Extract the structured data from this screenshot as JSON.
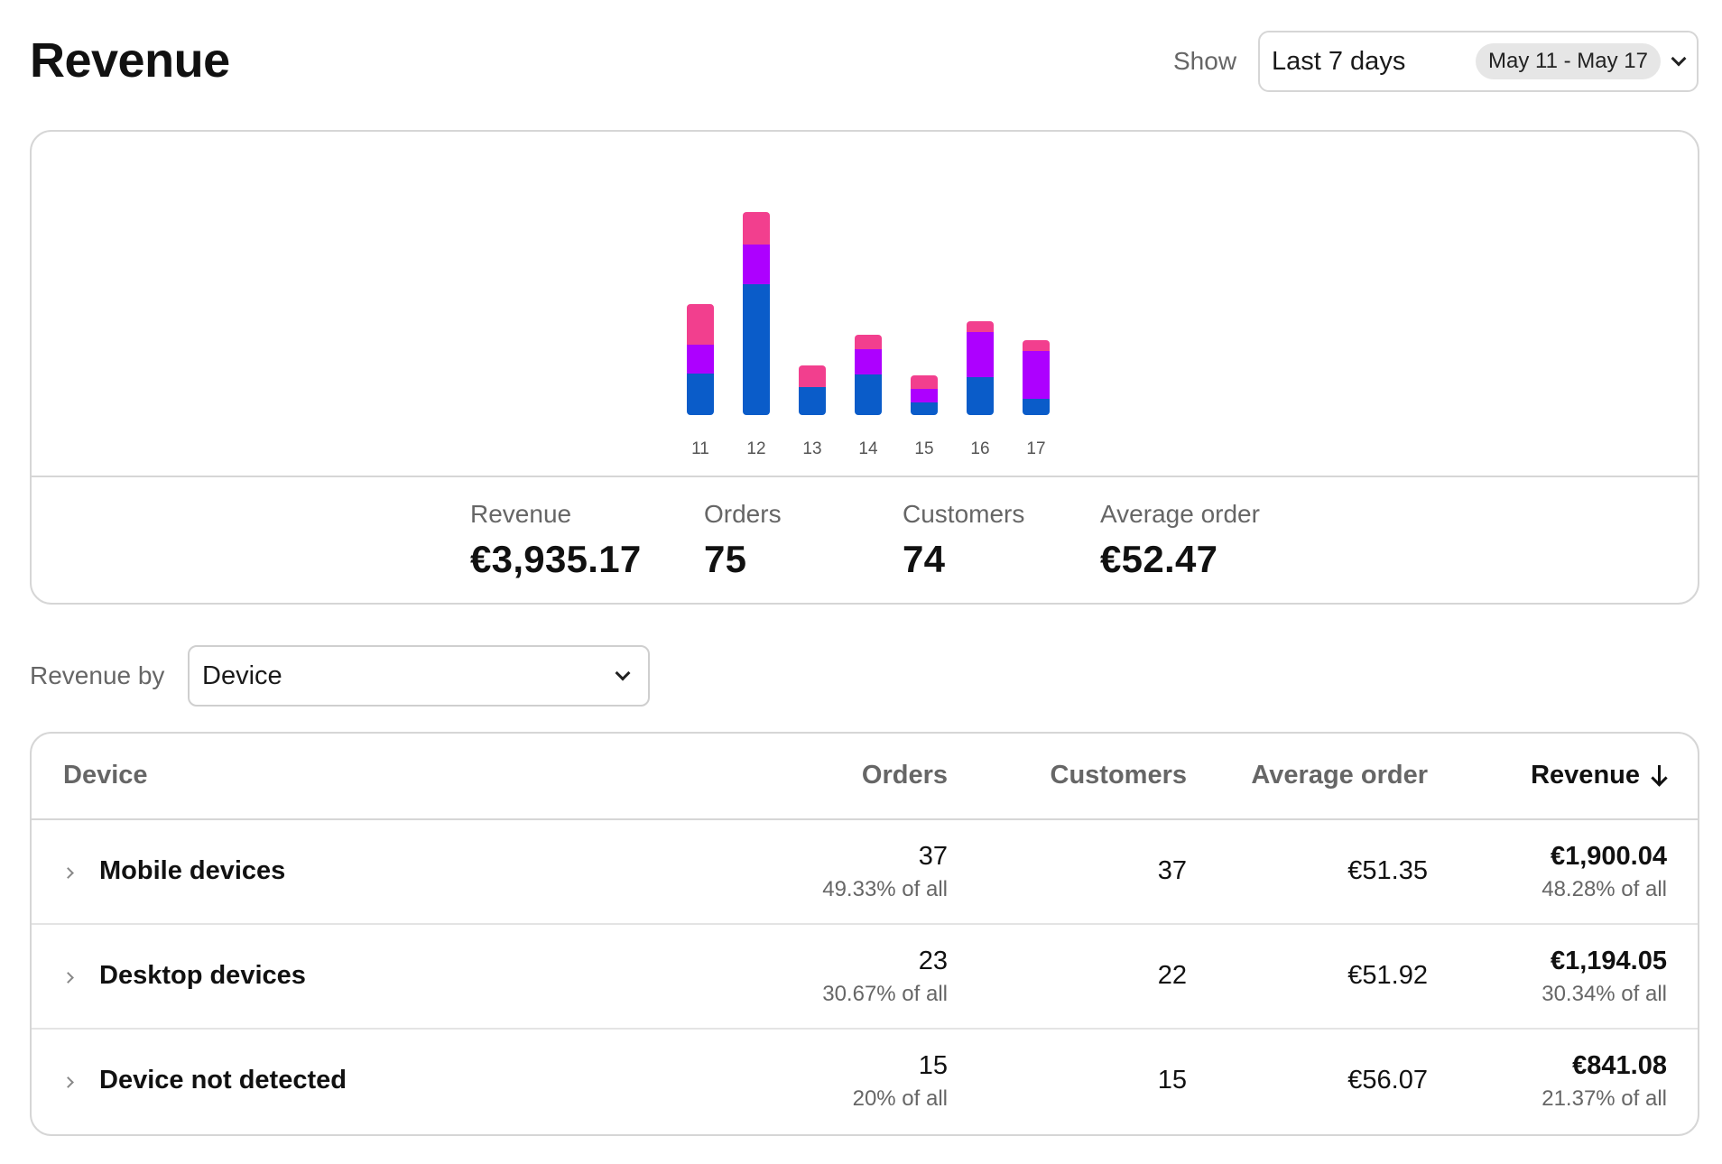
{
  "header": {
    "title": "Revenue",
    "show_label": "Show",
    "range_label": "Last 7 days",
    "range_pill": "May 11 - May 17"
  },
  "colors": {
    "blue": "#0a5cc9",
    "purple": "#ad00ff",
    "pink": "#f23f8e",
    "border": "#d6d6d6"
  },
  "chart_data": {
    "type": "bar",
    "stacked": true,
    "categories": [
      "11",
      "12",
      "13",
      "14",
      "15",
      "16",
      "17"
    ],
    "series": [
      {
        "color": "#0a5cc9",
        "values": [
          230,
          725,
          155,
          225,
          70,
          210,
          90
        ]
      },
      {
        "color": "#ad00ff",
        "values": [
          160,
          220,
          0,
          140,
          75,
          250,
          265
        ]
      },
      {
        "color": "#f23f8e",
        "values": [
          225,
          180,
          120,
          80,
          75,
          60,
          60
        ]
      }
    ],
    "xlabel": "",
    "ylabel": "",
    "grid": false
  },
  "summary": {
    "revenue_label": "Revenue",
    "revenue_value": "€3,935.17",
    "orders_label": "Orders",
    "orders_value": "75",
    "customers_label": "Customers",
    "customers_value": "74",
    "avg_label": "Average order",
    "avg_value": "€52.47"
  },
  "group_by": {
    "label": "Revenue by",
    "value": "Device"
  },
  "table": {
    "headers": {
      "device": "Device",
      "orders": "Orders",
      "customers": "Customers",
      "avg_order": "Average order",
      "revenue": "Revenue"
    },
    "rows": [
      {
        "name": "Mobile devices",
        "orders": "37",
        "orders_pct": "49.33% of all",
        "customers": "37",
        "avg_order": "€51.35",
        "revenue": "€1,900.04",
        "revenue_pct": "48.28% of all"
      },
      {
        "name": "Desktop devices",
        "orders": "23",
        "orders_pct": "30.67% of all",
        "customers": "22",
        "avg_order": "€51.92",
        "revenue": "€1,194.05",
        "revenue_pct": "30.34% of all"
      },
      {
        "name": "Device not detected",
        "orders": "15",
        "orders_pct": "20% of all",
        "customers": "15",
        "avg_order": "€56.07",
        "revenue": "€841.08",
        "revenue_pct": "21.37% of all"
      }
    ]
  }
}
